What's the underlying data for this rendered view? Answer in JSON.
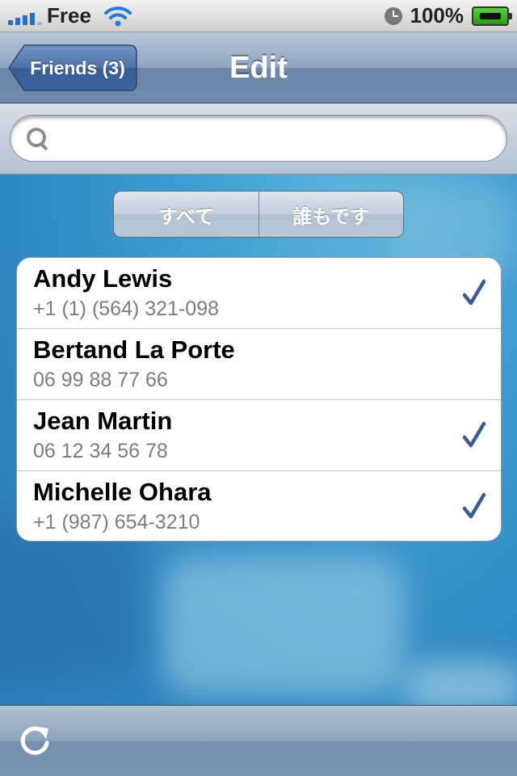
{
  "status_bar": {
    "carrier": "Free",
    "battery_percent": "100%"
  },
  "nav": {
    "back_label": "Friends (3)",
    "title": "Edit"
  },
  "search": {
    "placeholder": ""
  },
  "segments": [
    {
      "label": "すべて"
    },
    {
      "label": "誰もです"
    }
  ],
  "contacts": [
    {
      "name": "Andy Lewis",
      "phone": "+1 (1) (564) 321-098",
      "checked": true
    },
    {
      "name": "Bertand La Porte",
      "phone": "06 99 88 77 66",
      "checked": false
    },
    {
      "name": "Jean Martin",
      "phone": "06 12 34 56 78",
      "checked": true
    },
    {
      "name": "Michelle Ohara",
      "phone": "+1 (987) 654-3210",
      "checked": true
    }
  ],
  "colors": {
    "checkmark": "#3b5a8f",
    "signal": "#2a6cc9",
    "wifi": "#2a7bd6"
  },
  "icons": {
    "status": [
      "signal-icon",
      "wifi-icon",
      "clock-icon",
      "battery-icon"
    ],
    "search": "search-icon",
    "check": "checkmark-icon",
    "toolbar": "refresh-icon"
  }
}
